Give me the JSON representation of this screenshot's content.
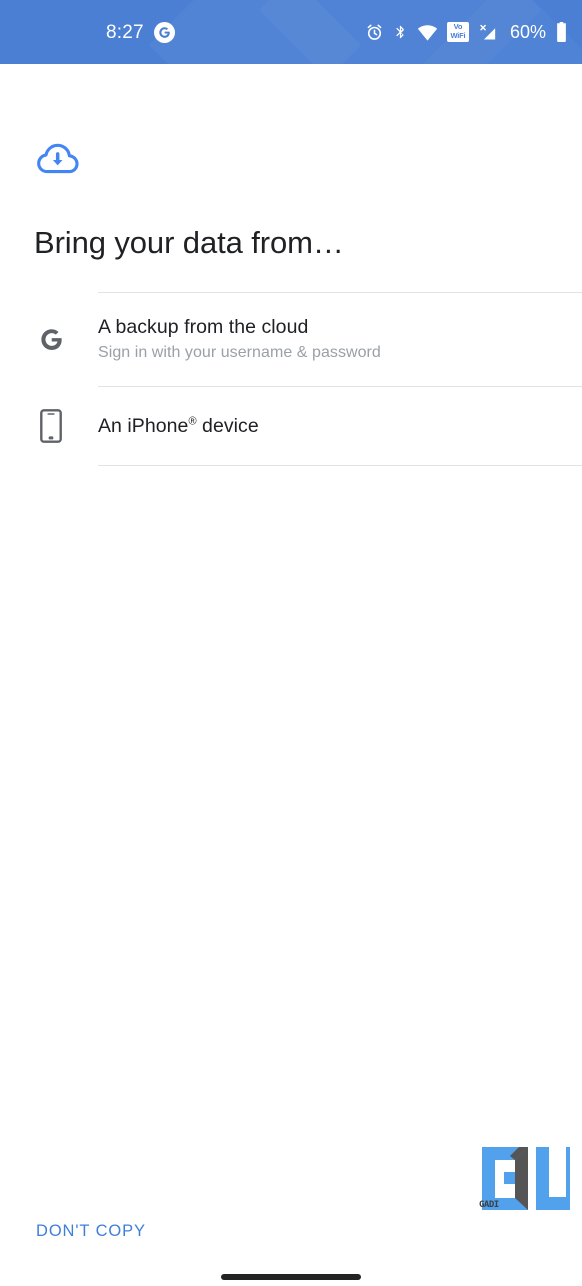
{
  "status_bar": {
    "time": "8:27",
    "assistant_icon": "google-g-icon",
    "icons": [
      "alarm-icon",
      "bluetooth-icon",
      "wifi-icon",
      "vowifi-icon",
      "mobile-signal-no-sim-icon"
    ],
    "vowifi_line1": "Vo",
    "vowifi_line2": "WiFi",
    "battery_percent": "60%",
    "battery_icon": "battery-icon",
    "background_color": "#4a7fd4"
  },
  "screen": {
    "hero_icon": "cloud-download-icon",
    "hero_icon_color": "#4285f4",
    "title": "Bring your data from…"
  },
  "options": [
    {
      "icon": "google-g-icon",
      "title": "A backup from the cloud",
      "subtitle": "Sign in with your username & password"
    },
    {
      "icon": "smartphone-icon",
      "title_prefix": "An iPhone",
      "title_sup": "®",
      "title_suffix": " device"
    }
  ],
  "footer": {
    "dont_copy_label": "DON'T COPY",
    "dont_copy_color": "#3f7fd8",
    "gesture_bar": "home-gesture-bar"
  },
  "watermark": {
    "label": "GADI",
    "brand_color": "#52a1ec",
    "shade_color": "#555555"
  }
}
